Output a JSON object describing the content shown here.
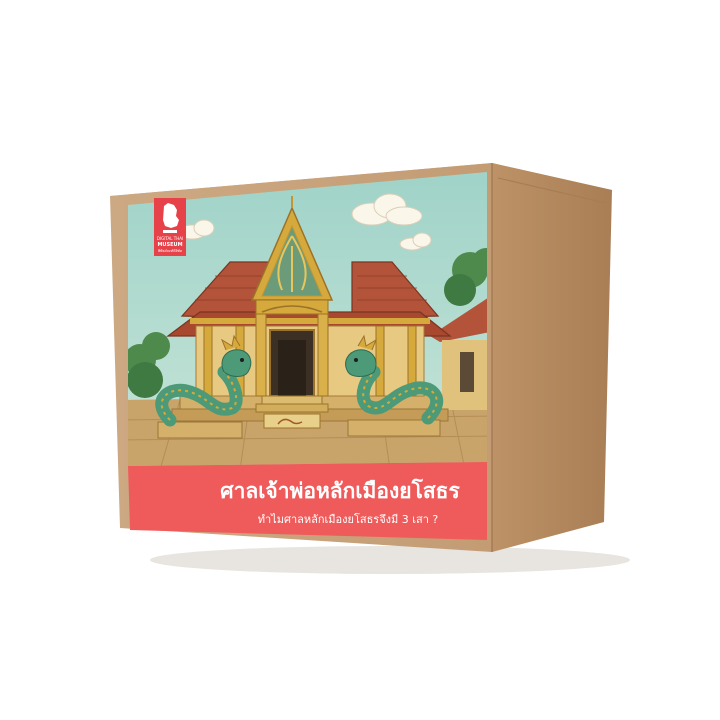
{
  "product": {
    "title": "ศาลเจ้าพ่อหลักเมืองยโสธร",
    "subtitle": "ทำไมศาลหลักเมืองยโสธรจึงมี 3 เสา ?"
  },
  "brand": {
    "logo_icon": "museum-lion-logo-icon",
    "lines": [
      "DIGITAL THAI",
      "MUSEUM",
      "พิพิธภัณฑ์ดิจิทัล"
    ]
  },
  "colors": {
    "cardboard_front": "#c8a37a",
    "cardboard_side": "#b48a5f",
    "cardboard_top": "#d2ae86",
    "banner": "#ef5b5b",
    "sky": "#a9d6cc",
    "roof": "#b3533a",
    "naga": "#4c9a78",
    "gold": "#d6a93c"
  }
}
